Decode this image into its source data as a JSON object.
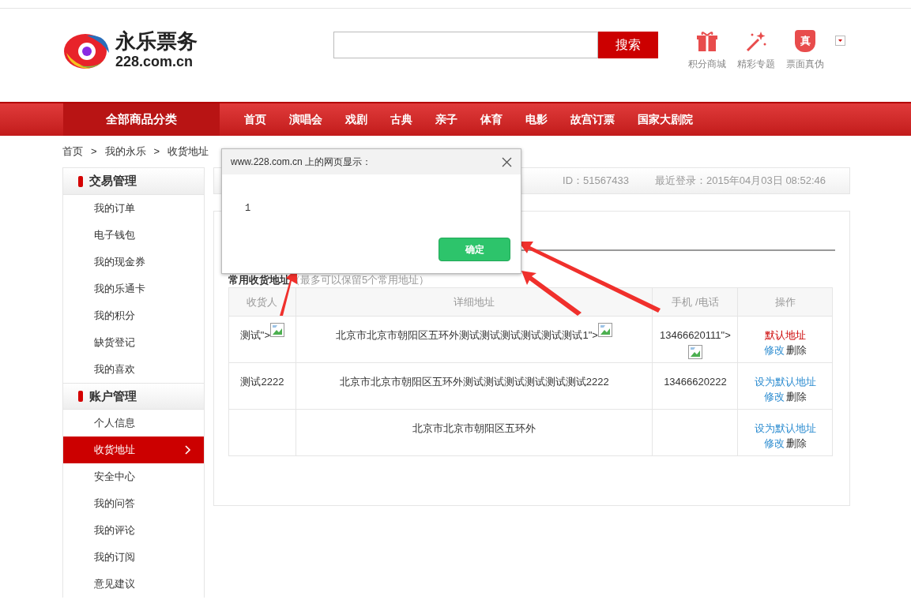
{
  "header": {
    "logo_text": "永乐票务",
    "logo_domain": "228.com.cn",
    "search_button": "搜索",
    "links": [
      {
        "kind": "gift",
        "label": "积分商城"
      },
      {
        "kind": "wand",
        "label": "精彩专题"
      },
      {
        "kind": "shield",
        "label": "票面真伪",
        "mark": "真"
      }
    ]
  },
  "nav": {
    "category": "全部商品分类",
    "items": [
      "首页",
      "演唱会",
      "戏剧",
      "古典",
      "亲子",
      "体育",
      "电影",
      "故宫订票",
      "国家大剧院"
    ]
  },
  "breadcrumb": [
    "首页",
    "我的永乐",
    "收货地址"
  ],
  "breadcrumb_separator": ">",
  "sidebar": [
    {
      "title": "交易管理",
      "items": [
        {
          "label": "我的订单",
          "selected": false
        },
        {
          "label": "电子钱包",
          "selected": false
        },
        {
          "label": "我的现金券",
          "selected": false
        },
        {
          "label": "我的乐通卡",
          "selected": false
        },
        {
          "label": "我的积分",
          "selected": false
        },
        {
          "label": "缺货登记",
          "selected": false
        },
        {
          "label": "我的喜欢",
          "selected": false
        }
      ]
    },
    {
      "title": "账户管理",
      "items": [
        {
          "label": "个人信息",
          "selected": false
        },
        {
          "label": "收货地址",
          "selected": true
        },
        {
          "label": "安全中心",
          "selected": false
        },
        {
          "label": "我的问答",
          "selected": false
        },
        {
          "label": "我的评论",
          "selected": false
        },
        {
          "label": "我的订阅",
          "selected": false
        },
        {
          "label": "意见建议",
          "selected": false
        }
      ]
    }
  ],
  "info_bar": {
    "id": "ID：51567433",
    "last_login": "最近登录：2015年04月03日 08:52:46"
  },
  "section": {
    "title": "常用收货地址",
    "hint": "（最多可以保留5个常用地址）"
  },
  "table": {
    "columns": [
      "收货人",
      "详细地址",
      "手机 /电话",
      "操作"
    ],
    "rows": [
      {
        "name": "测试\">",
        "name_broken_image": true,
        "address": "北京市北京市朝阳区五环外测试测试测试测试测试测试1\">",
        "address_broken_image": true,
        "phone": "13466620111\">",
        "phone_broken_image": true,
        "is_default": true,
        "default_label": "默认地址",
        "edit": "修改",
        "delete": "删除"
      },
      {
        "name": "测试2222",
        "name_broken_image": false,
        "address": "北京市北京市朝阳区五环外测试测试测试测试测试测试2222",
        "address_broken_image": false,
        "phone": "13466620222",
        "phone_broken_image": false,
        "is_default": false,
        "default_label": "设为默认地址",
        "edit": "修改",
        "delete": "删除"
      },
      {
        "address": "北京市北京市朝阳区五环外",
        "address_broken_image": false,
        "name_broken_image": false,
        "phone_broken_image": false,
        "is_default": false,
        "default_label": "设为默认地址",
        "edit": "修改",
        "delete": "删除"
      }
    ]
  },
  "dialog": {
    "title": "www.228.com.cn 上的网页显示：",
    "message": "1",
    "ok": "确定"
  }
}
